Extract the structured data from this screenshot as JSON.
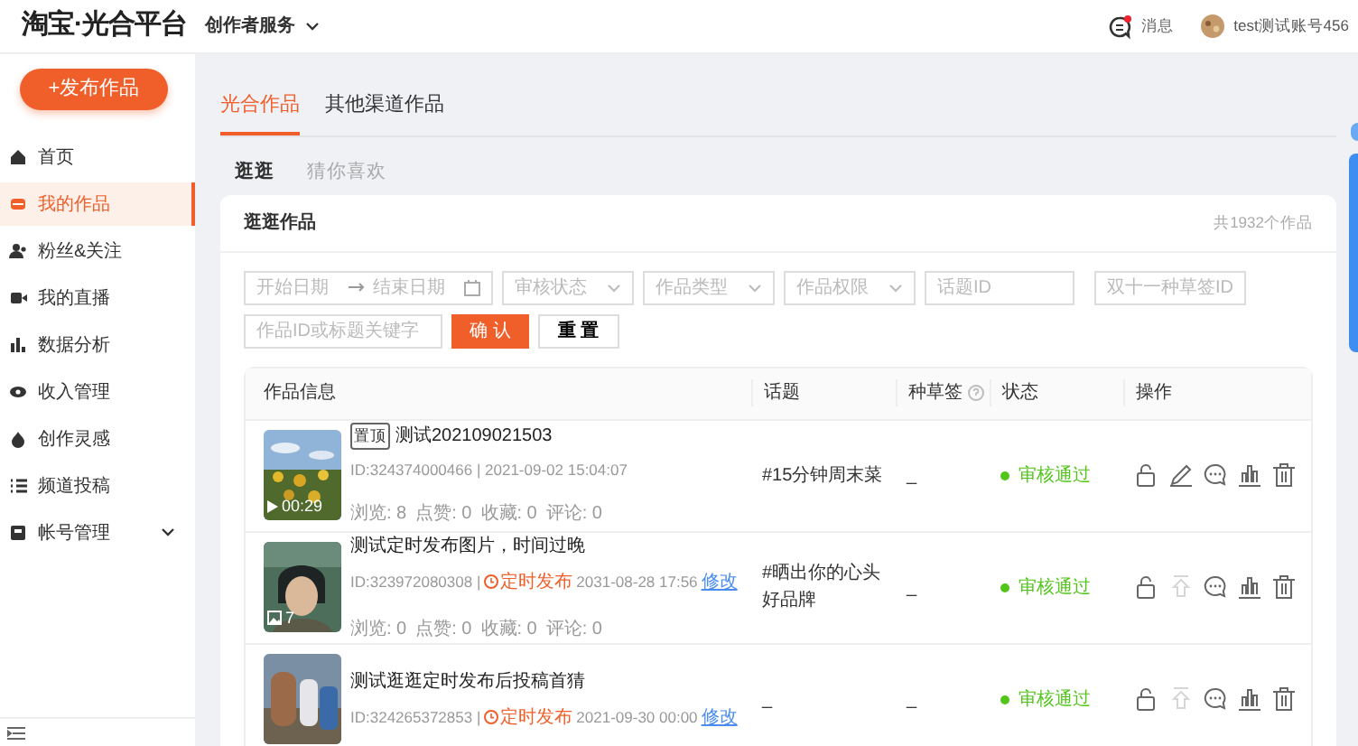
{
  "header": {
    "logo": "淘宝·光合平台",
    "service_menu": "创作者服务",
    "messages": {
      "label": "消息",
      "unread": true
    },
    "account": "test测试账号456"
  },
  "sidebar": {
    "publish_button": "+发布作品",
    "items": [
      {
        "kind": "home",
        "label": "首页",
        "selected": false
      },
      {
        "kind": "works",
        "label": "我的作品",
        "selected": true
      },
      {
        "kind": "fans",
        "label": "粉丝&关注",
        "selected": false
      },
      {
        "kind": "live",
        "label": "我的直播",
        "selected": false
      },
      {
        "kind": "data",
        "label": "数据分析",
        "selected": false
      },
      {
        "kind": "income",
        "label": "收入管理",
        "selected": false
      },
      {
        "kind": "idea",
        "label": "创作灵感",
        "selected": false
      },
      {
        "kind": "channel",
        "label": "频道投稿",
        "selected": false
      },
      {
        "kind": "account",
        "label": "帐号管理",
        "selected": false,
        "expandable": true
      }
    ]
  },
  "tabs": [
    {
      "label": "光合作品",
      "selected": true
    },
    {
      "label": "其他渠道作品",
      "selected": false
    }
  ],
  "subtabs": [
    {
      "label": "逛逛",
      "selected": true
    },
    {
      "label": "猜你喜欢",
      "selected": false
    }
  ],
  "card": {
    "title": "逛逛作品",
    "total": "共1932个作品"
  },
  "filters": {
    "start_date": "开始日期",
    "end_date": "结束日期",
    "selects": [
      "审核状态",
      "作品类型",
      "作品权限"
    ],
    "inputs": [
      {
        "placeholder": "话题ID"
      },
      {
        "placeholder": "双十一种草签ID"
      }
    ],
    "keyword": {
      "placeholder": "作品ID或标题关键字"
    },
    "confirm": "确 认",
    "reset": "重 置"
  },
  "table": {
    "columns": [
      "作品信息",
      "话题",
      "种草签",
      "状态",
      "操作"
    ],
    "rows": [
      {
        "pinned_label": "置顶",
        "title": "测试202109021503",
        "id": "ID:324374000466 | 2021-09-02 15:04:07",
        "media": {
          "kind": "video",
          "text": "00:29"
        },
        "stats": [
          "浏览: 8",
          "点赞: 0",
          "收藏: 0",
          "评论: 0"
        ],
        "topic": "#15分钟周末菜",
        "tag": "_",
        "status": "审核通过",
        "actions": [
          {
            "kind": "unlock",
            "disabled": false
          },
          {
            "kind": "edit",
            "disabled": false
          },
          {
            "kind": "comment",
            "disabled": false
          },
          {
            "kind": "stats",
            "disabled": false
          },
          {
            "kind": "delete",
            "disabled": false
          }
        ]
      },
      {
        "title": "测试定时发布图片，时间过晚",
        "id": "ID:323972080308 |",
        "schedule": {
          "label": "定时发布",
          "time": "2031-08-28 17:56",
          "link": "修改"
        },
        "media": {
          "kind": "images",
          "text": "7"
        },
        "stats": [
          "浏览: 0",
          "点赞: 0",
          "收藏: 0",
          "评论: 0"
        ],
        "topic": "#晒出你的心头好品牌",
        "tag": "_",
        "status": "审核通过",
        "actions": [
          {
            "kind": "unlock",
            "disabled": false
          },
          {
            "kind": "top",
            "disabled": true
          },
          {
            "kind": "comment",
            "disabled": false
          },
          {
            "kind": "stats",
            "disabled": false
          },
          {
            "kind": "delete",
            "disabled": false
          }
        ]
      },
      {
        "title": "测试逛逛定时发布后投稿首猜",
        "id": "ID:324265372853 |",
        "schedule": {
          "label": "定时发布",
          "time": "2021-09-30 00:00",
          "link": "修改"
        },
        "topic": "_",
        "tag": "_",
        "status": "审核通过",
        "actions": [
          {
            "kind": "unlock",
            "disabled": false
          },
          {
            "kind": "top",
            "disabled": true
          },
          {
            "kind": "comment",
            "disabled": false
          },
          {
            "kind": "stats",
            "disabled": false
          },
          {
            "kind": "delete",
            "disabled": false
          }
        ]
      }
    ]
  }
}
